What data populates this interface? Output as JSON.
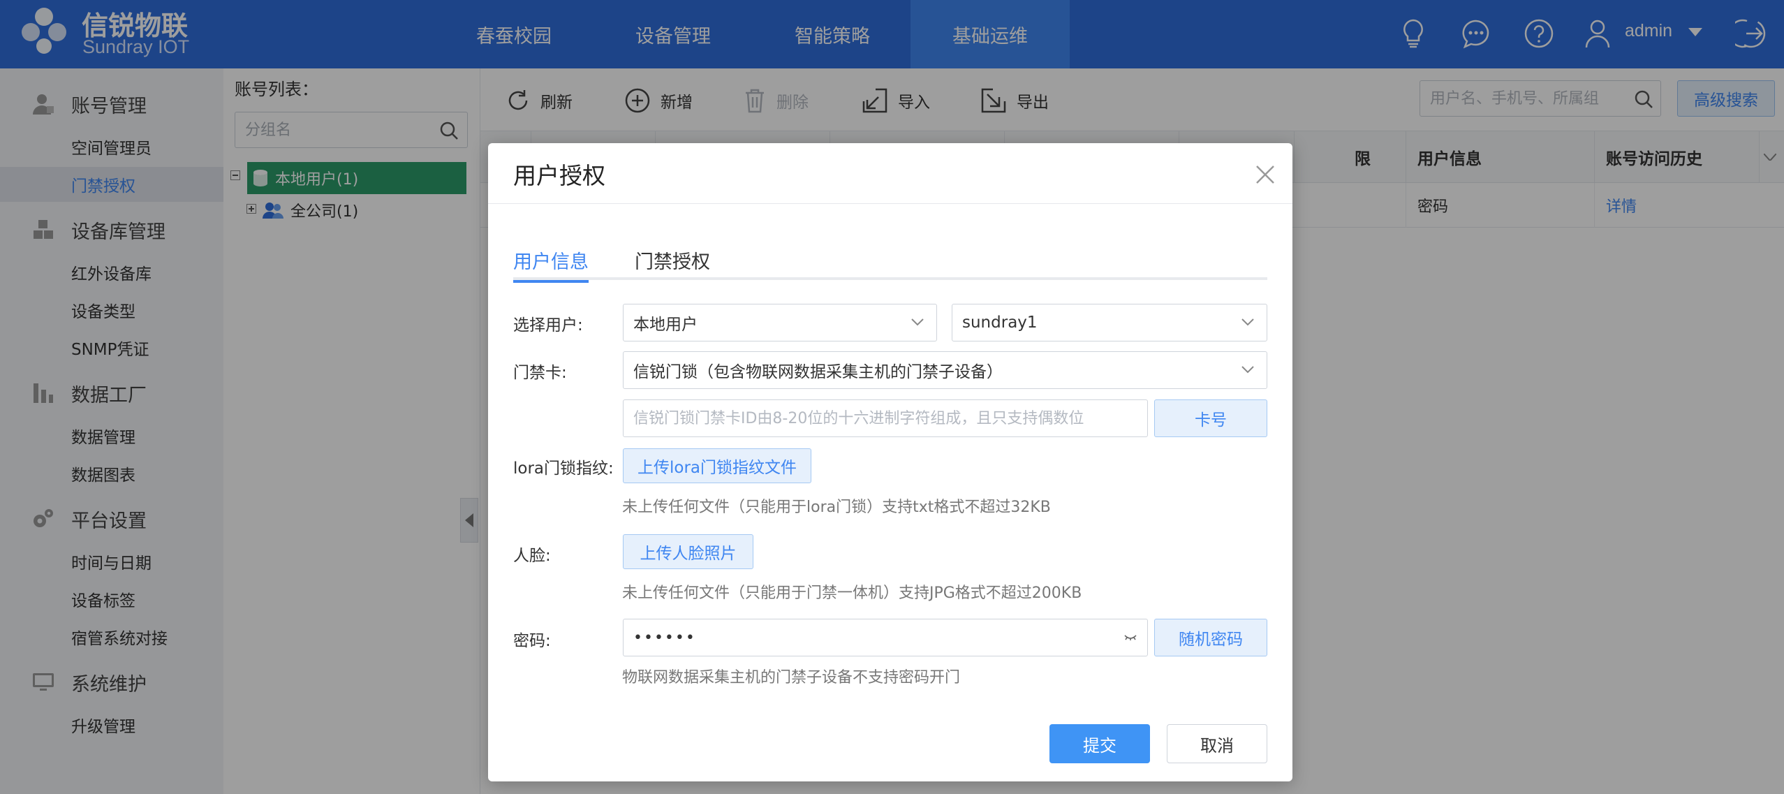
{
  "brand": {
    "name_cn": "信锐物联",
    "name_en": "Sundray IOT"
  },
  "nav": [
    {
      "label": "春蚕校园"
    },
    {
      "label": "设备管理"
    },
    {
      "label": "智能策略"
    },
    {
      "label": "基础运维",
      "active": true
    }
  ],
  "header": {
    "user": "admin",
    "icons": [
      "lightbulb-icon",
      "chat-icon",
      "help-icon",
      "user-icon",
      "logout-icon"
    ]
  },
  "sidebar": {
    "groups": [
      {
        "label": "账号管理",
        "icon": "user-icon",
        "items": [
          {
            "label": "空间管理员"
          },
          {
            "label": "门禁授权",
            "active": true
          }
        ]
      },
      {
        "label": "设备库管理",
        "icon": "cubes-icon",
        "items": [
          {
            "label": "红外设备库"
          },
          {
            "label": "设备类型"
          },
          {
            "label": "SNMP凭证"
          }
        ]
      },
      {
        "label": "数据工厂",
        "icon": "chart-icon",
        "items": [
          {
            "label": "数据管理"
          },
          {
            "label": "数据图表"
          }
        ]
      },
      {
        "label": "平台设置",
        "icon": "gears-icon",
        "items": [
          {
            "label": "时间与日期"
          },
          {
            "label": "设备标签"
          },
          {
            "label": "宿管系统对接"
          }
        ]
      },
      {
        "label": "系统维护",
        "icon": "monitor-icon",
        "items": [
          {
            "label": "升级管理"
          }
        ]
      }
    ]
  },
  "tree": {
    "title": "账号列表：",
    "search_placeholder": "分组名",
    "nodes": [
      {
        "label": "本地用户(1)",
        "selected": true
      },
      {
        "label": "全公司(1)"
      }
    ]
  },
  "toolbar": {
    "refresh": "刷新",
    "add": "新增",
    "delete": "删除",
    "import": "导入",
    "export": "导出",
    "search_placeholder": "用户名、手机号、所属组",
    "advanced_search": "高级搜索"
  },
  "table": {
    "headers": [
      "限",
      "用户信息",
      "账号访问历史"
    ],
    "rows": [
      [
        "密码",
        "详情"
      ]
    ]
  },
  "modal": {
    "title": "用户授权",
    "tabs": [
      {
        "label": "用户信息",
        "active": true
      },
      {
        "label": "门禁授权"
      }
    ],
    "select_user_label": "选择用户:",
    "user_source": "本地用户",
    "user_name": "sundray1",
    "card_label": "门禁卡:",
    "card_type": "信锐门锁（包含物联网数据采集主机的门禁子设备）",
    "card_placeholder": "信锐门锁门禁卡ID由8-20位的十六进制字符组成，且只支持偶数位",
    "card_button": "卡号",
    "lora_label": "lora门锁指纹:",
    "lora_button": "上传lora门锁指纹文件",
    "lora_hint": "未上传任何文件（只能用于lora门锁）支持txt格式不超过32KB",
    "face_label": "人脸:",
    "face_button": "上传人脸照片",
    "face_hint": "未上传任何文件（只能用于门禁一体机）支持JPG格式不超过200KB",
    "password_label": "密码:",
    "password_value": "••••••",
    "password_button": "随机密码",
    "password_hint": "物联网数据采集主机的门禁子设备不支持密码开门",
    "submit": "提交",
    "cancel": "取消"
  }
}
